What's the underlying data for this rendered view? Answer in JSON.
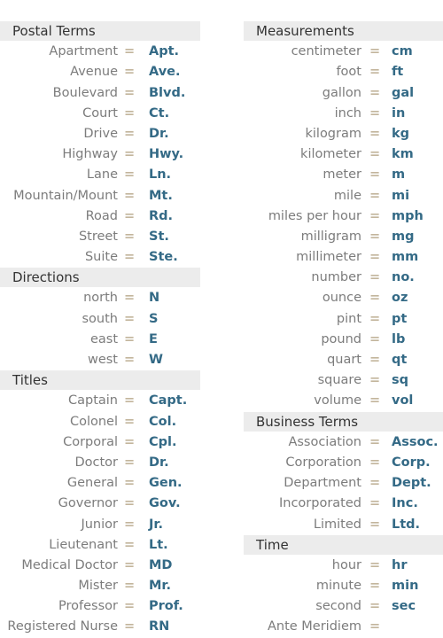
{
  "left_column": [
    {
      "header": "Postal Terms",
      "items": [
        {
          "term": "Apartment",
          "abbr": "Apt."
        },
        {
          "term": "Avenue",
          "abbr": "Ave."
        },
        {
          "term": "Boulevard",
          "abbr": "Blvd."
        },
        {
          "term": "Court",
          "abbr": "Ct."
        },
        {
          "term": "Drive",
          "abbr": "Dr."
        },
        {
          "term": "Highway",
          "abbr": "Hwy."
        },
        {
          "term": "Lane",
          "abbr": "Ln."
        },
        {
          "term": "Mountain/Mount",
          "abbr": "Mt."
        },
        {
          "term": "Road",
          "abbr": "Rd."
        },
        {
          "term": "Street",
          "abbr": "St."
        },
        {
          "term": "Suite",
          "abbr": "Ste."
        }
      ]
    },
    {
      "header": "Directions",
      "items": [
        {
          "term": "north",
          "abbr": "N"
        },
        {
          "term": "south",
          "abbr": "S"
        },
        {
          "term": "east",
          "abbr": "E"
        },
        {
          "term": "west",
          "abbr": "W"
        }
      ]
    },
    {
      "header": "Titles",
      "items": [
        {
          "term": "Captain",
          "abbr": "Capt."
        },
        {
          "term": "Colonel",
          "abbr": "Col."
        },
        {
          "term": "Corporal",
          "abbr": "Cpl."
        },
        {
          "term": "Doctor",
          "abbr": "Dr."
        },
        {
          "term": "General",
          "abbr": "Gen."
        },
        {
          "term": "Governor",
          "abbr": "Gov."
        },
        {
          "term": "Junior",
          "abbr": "Jr."
        },
        {
          "term": "Lieutenant",
          "abbr": "Lt."
        },
        {
          "term": "Medical Doctor",
          "abbr": "MD"
        },
        {
          "term": "Mister",
          "abbr": "Mr."
        },
        {
          "term": "Professor",
          "abbr": "Prof."
        },
        {
          "term": "Registered Nurse",
          "abbr": "RN"
        }
      ]
    }
  ],
  "right_column": [
    {
      "header": "Measurements",
      "items": [
        {
          "term": "centimeter",
          "abbr": "cm"
        },
        {
          "term": "foot",
          "abbr": "ft"
        },
        {
          "term": "gallon",
          "abbr": "gal"
        },
        {
          "term": "inch",
          "abbr": "in"
        },
        {
          "term": "kilogram",
          "abbr": "kg"
        },
        {
          "term": "kilometer",
          "abbr": "km"
        },
        {
          "term": "meter",
          "abbr": "m"
        },
        {
          "term": "mile",
          "abbr": "mi"
        },
        {
          "term": "miles per hour",
          "abbr": "mph"
        },
        {
          "term": "milligram",
          "abbr": "mg"
        },
        {
          "term": "millimeter",
          "abbr": "mm"
        },
        {
          "term": "number",
          "abbr": "no."
        },
        {
          "term": "ounce",
          "abbr": "oz"
        },
        {
          "term": "pint",
          "abbr": "pt"
        },
        {
          "term": "pound",
          "abbr": "lb"
        },
        {
          "term": "quart",
          "abbr": "qt"
        },
        {
          "term": "square",
          "abbr": "sq"
        },
        {
          "term": "volume",
          "abbr": "vol"
        }
      ]
    },
    {
      "header": "Business Terms",
      "items": [
        {
          "term": "Association",
          "abbr": "Assoc."
        },
        {
          "term": "Corporation",
          "abbr": "Corp."
        },
        {
          "term": "Department",
          "abbr": "Dept."
        },
        {
          "term": "Incorporated",
          "abbr": "Inc."
        },
        {
          "term": "Limited",
          "abbr": "Ltd."
        }
      ]
    },
    {
      "header": "Time",
      "items": [
        {
          "term": "hour",
          "abbr": "hr"
        },
        {
          "term": "minute",
          "abbr": "min"
        },
        {
          "term": "second",
          "abbr": "sec"
        },
        {
          "term": "Ante Meridiem",
          "abbr": ""
        }
      ]
    }
  ],
  "equals_sign": "=",
  "colors": {
    "term": "#7c7c7c",
    "equals": "#c3b59c",
    "abbr": "#346a86",
    "header_bg": "#ececec"
  }
}
